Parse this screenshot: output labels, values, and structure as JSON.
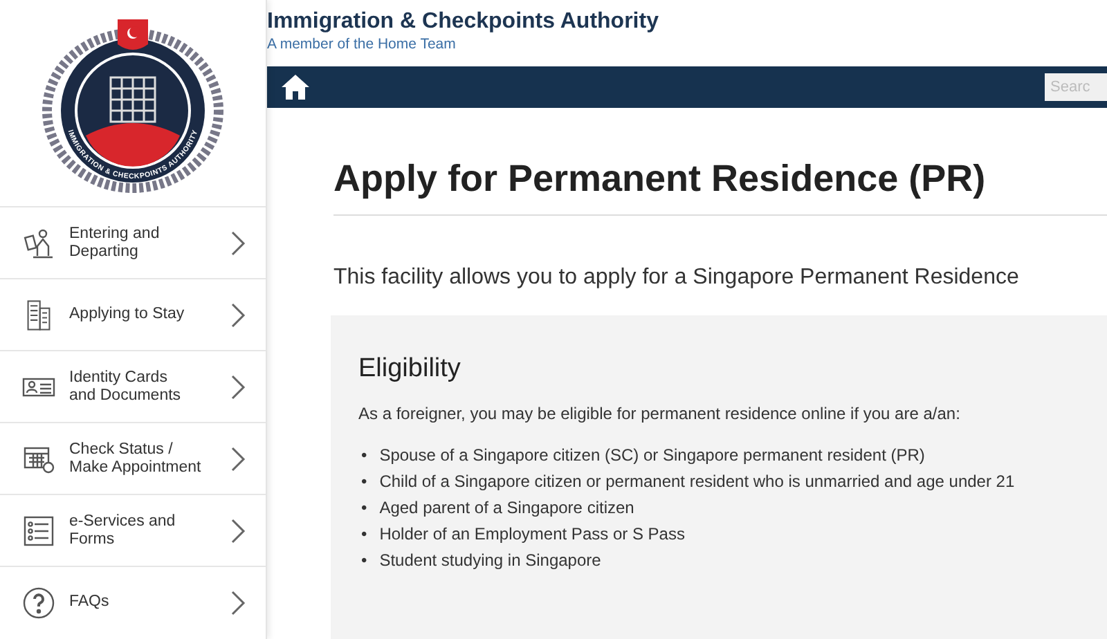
{
  "logo": {
    "ring_text": "IMMIGRATION & CHECKPOINTS AUTHORITY"
  },
  "header": {
    "title": "Immigration & Checkpoints Authority",
    "subtitle": "A member of the Home Team"
  },
  "nav": {
    "search": {
      "placeholder": "Searc"
    }
  },
  "sidebar": {
    "items": [
      {
        "kind": "travel",
        "label": "Entering and\nDeparting"
      },
      {
        "kind": "building",
        "label": "Applying to Stay"
      },
      {
        "kind": "idcard",
        "label": "Identity Cards\nand Documents"
      },
      {
        "kind": "calendar",
        "label": "Check Status /\nMake Appointment"
      },
      {
        "kind": "list",
        "label": "e-Services and\nForms"
      },
      {
        "kind": "faq",
        "label": "FAQs"
      }
    ]
  },
  "page": {
    "title": "Apply for Permanent Residence (PR)",
    "intro": "This facility allows you to apply for a Singapore Permanent Residence",
    "eligibility": {
      "heading": "Eligibility",
      "text": "As a foreigner, you may be eligible for permanent residence online if you are a/an:",
      "items": [
        {
          "bullet": "•",
          "text": "Spouse of a Singapore citizen (SC) or Singapore permanent resident (PR)"
        },
        {
          "bullet": "•",
          "text": "Child of a Singapore citizen or permanent resident who is unmarried and age under 21"
        },
        {
          "bullet": "•",
          "text": "Aged parent of a Singapore citizen"
        },
        {
          "bullet": "•",
          "text": "Holder of an Employment Pass or S Pass"
        },
        {
          "bullet": "•",
          "text": "Student studying in Singapore"
        }
      ]
    }
  }
}
